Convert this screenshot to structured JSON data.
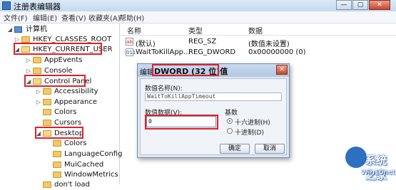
{
  "window": {
    "title": "注册表编辑器",
    "minimize": "—",
    "maximize": "▢",
    "close": "✕"
  },
  "menu": [
    "文件(F)",
    "编辑(E)",
    "查看(V)",
    "收藏夹(A)",
    "帮助(H)"
  ],
  "tree": {
    "computer": "计算机",
    "nodes": [
      {
        "label": "HKEY_CLASSES_ROOT",
        "arrow": "▷"
      },
      {
        "label": "HKEY_CURRENT_USER",
        "arrow": "◢"
      },
      {
        "label": "AppEvents",
        "arrow": "▷"
      },
      {
        "label": "Console",
        "arrow": "▷"
      },
      {
        "label": "Control Panel",
        "arrow": "◢"
      },
      {
        "label": "Accessibility",
        "arrow": "▷"
      },
      {
        "label": "Appearance",
        "arrow": "▷"
      },
      {
        "label": "Colors",
        "arrow": ""
      },
      {
        "label": "Cursors",
        "arrow": ""
      },
      {
        "label": "Desktop",
        "arrow": "◢"
      },
      {
        "label": "Colors",
        "arrow": ""
      },
      {
        "label": "LanguageConfig",
        "arrow": ""
      },
      {
        "label": "MuiCached",
        "arrow": ""
      },
      {
        "label": "WindowMetrics",
        "arrow": ""
      },
      {
        "label": "don't load",
        "arrow": ""
      }
    ]
  },
  "columns": {
    "name": "名称",
    "type": "类型",
    "data": "数据"
  },
  "values": [
    {
      "icon": "ab",
      "name": "(默认)",
      "type": "REG_SZ",
      "data": "(数值未设置)"
    },
    {
      "icon": "011",
      "name": "WaitToKillApp...",
      "type": "REG_DWORD",
      "data": "0x00000000 (0)"
    }
  ],
  "dialog": {
    "title_prefix": "编辑",
    "title_main": "DWORD (32 位)值",
    "close": "✕",
    "name_label": "数值名称(N):",
    "name_value": "WaitToKillAppTimeout",
    "data_label": "数值数据(V):",
    "data_value": "0",
    "base_label": "基数",
    "radio_hex": "十六进制(H)",
    "radio_dec": "十进制(D)",
    "selected_base": "hex",
    "ok": "确定",
    "cancel": "取消"
  },
  "watermark": {
    "title": "系统之家",
    "url": "Win10net..."
  }
}
